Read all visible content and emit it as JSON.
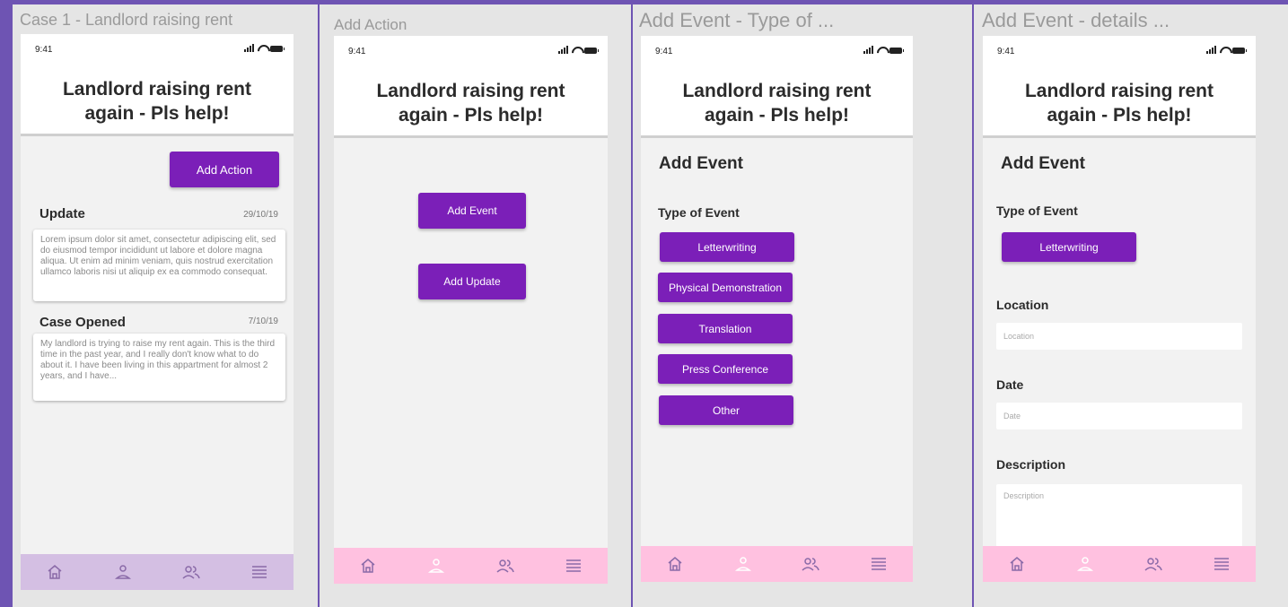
{
  "frames": [
    {
      "title": "Case 1 - Landlord raising rent",
      "time": "9:41",
      "case_title_line1": "Landlord raising rent",
      "case_title_line2": "again - Pls help!",
      "add_action_label": "Add Action",
      "entries": [
        {
          "title": "Update",
          "date": "29/10/19",
          "text": "Lorem ipsum dolor sit amet, consectetur adipiscing elit, sed do eiusmod tempor incididunt ut labore et dolore magna aliqua. Ut enim ad minim veniam, quis nostrud exercitation ullamco laboris nisi ut aliquip ex ea commodo consequat."
        },
        {
          "title": "Case Opened",
          "date": "7/10/19",
          "text": "My landlord is trying to raise my rent again. This is the third time in the past year, and I really don't know what to do about it. I have been living in this appartment for almost 2 years, and I have..."
        }
      ]
    },
    {
      "title": "Add Action",
      "time": "9:41",
      "case_title_line1": "Landlord raising rent",
      "case_title_line2": "again - Pls help!",
      "add_event_label": "Add Event",
      "add_update_label": "Add Update"
    },
    {
      "title": "Add Event - Type of ...",
      "time": "9:41",
      "case_title_line1": "Landlord raising rent",
      "case_title_line2": "again - Pls help!",
      "heading": "Add Event",
      "type_label": "Type of Event",
      "options": [
        "Letterwriting",
        "Physical Demonstration",
        "Translation",
        "Press Conference",
        "Other"
      ]
    },
    {
      "title": "Add Event - details ...",
      "time": "9:41",
      "case_title_line1": "Landlord raising rent",
      "case_title_line2": "again - Pls help!",
      "heading": "Add Event",
      "type_label": "Type of Event",
      "selected_type": "Letterwriting",
      "location_label": "Location",
      "location_placeholder": "Location",
      "date_label": "Date",
      "date_placeholder": "Date",
      "description_label": "Description",
      "description_placeholder": "Description"
    }
  ],
  "colors": {
    "accent": "#7b1fb8",
    "tabbar_case": "#d4bfe3",
    "tabbar_pink": "#ffc1e0",
    "desktop": "#6e54b3"
  },
  "tab_icons": [
    "home-icon",
    "profile-icon",
    "people-icon",
    "menu-icon"
  ]
}
